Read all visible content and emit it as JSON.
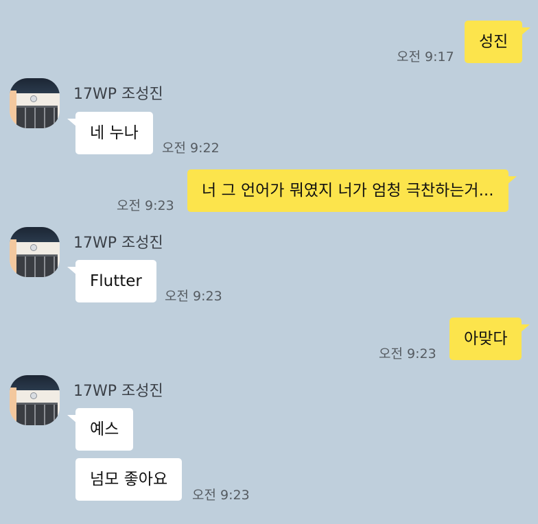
{
  "contact": {
    "name": "17WP 조성진"
  },
  "messages": {
    "m1": {
      "text": "성진",
      "time": "오전 9:17",
      "from": "me"
    },
    "m2": {
      "text": "네 누나",
      "time": "오전 9:22",
      "from": "them"
    },
    "m3": {
      "text": "너 그 언어가 뭐였지 너가 엄청 극찬하는거...",
      "time": "오전 9:23",
      "from": "me"
    },
    "m4": {
      "text": "Flutter",
      "time": "오전 9:23",
      "from": "them"
    },
    "m5": {
      "text": "아맞다",
      "time": "오전 9:23",
      "from": "me"
    },
    "m6": {
      "text": "예스",
      "from": "them"
    },
    "m7": {
      "text": "넘모 좋아요",
      "time": "오전 9:23",
      "from": "them"
    }
  },
  "colors": {
    "background": "#bfcfdc",
    "my_bubble": "#fce44c",
    "their_bubble": "#ffffff",
    "time_text": "#555b61"
  },
  "icons": {
    "avatar": "laptop-keyboard-photo"
  }
}
